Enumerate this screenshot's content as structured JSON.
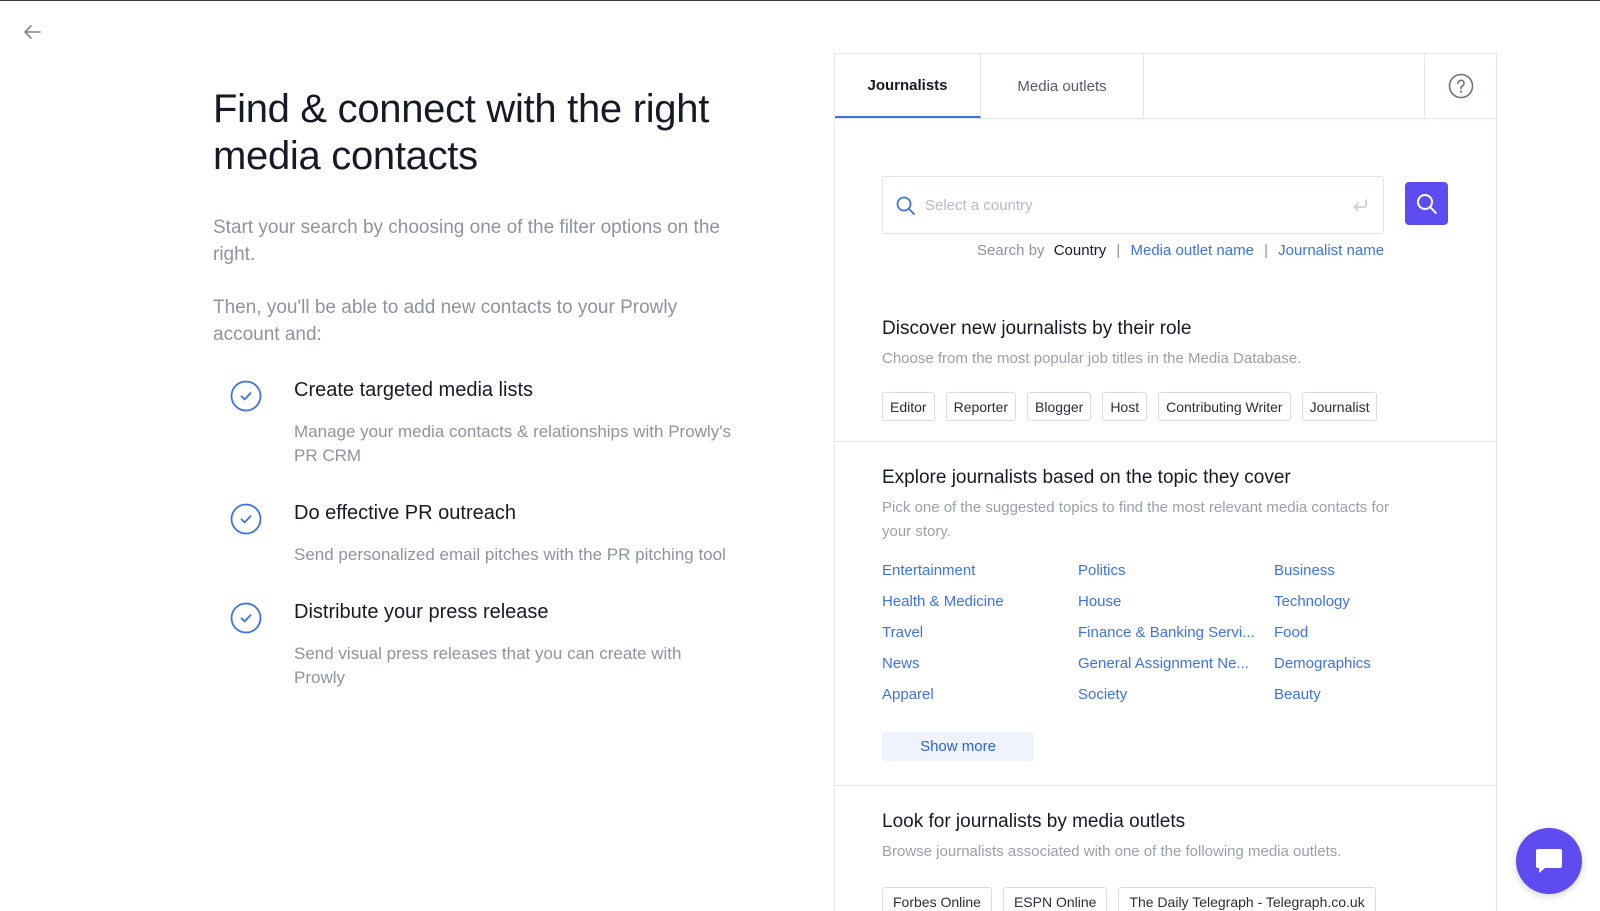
{
  "hero": {
    "title": "Find & connect with the right media contacts",
    "intro": "Start your search by choosing one of the filter options on the right.",
    "intro2": "Then, you'll be able to add new contacts to your Prowly account and:"
  },
  "features": [
    {
      "title": "Create targeted media lists",
      "desc": "Manage your media contacts & relationships with Prowly's PR CRM"
    },
    {
      "title": "Do effective PR outreach",
      "desc": "Send personalized email pitches with the PR pitching tool"
    },
    {
      "title": "Distribute your press release",
      "desc": "Send visual press releases that you can create with Prowly"
    }
  ],
  "tabs": {
    "journalists": "Journalists",
    "outlets": "Media outlets"
  },
  "search": {
    "placeholder": "Select a country",
    "search_by_label": "Search by",
    "options": [
      "Country",
      "Media outlet name",
      "Journalist name"
    ],
    "separator": "|"
  },
  "roles": {
    "title": "Discover new journalists by their role",
    "subtitle": "Choose from the most popular job titles in the Media Database.",
    "chips": [
      "Editor",
      "Reporter",
      "Blogger",
      "Host",
      "Contributing Writer",
      "Journalist"
    ]
  },
  "topics": {
    "title": "Explore journalists based on the topic they cover",
    "subtitle": "Pick one of the suggested topics to find the most relevant media contacts for your story.",
    "items": [
      "Entertainment",
      "Politics",
      "Business",
      "Health & Medicine",
      "House",
      "Technology",
      "Travel",
      "Finance & Banking Servi...",
      "Food",
      "News",
      "General Assignment Ne...",
      "Demographics",
      "Apparel",
      "Society",
      "Beauty"
    ],
    "show_more": "Show more"
  },
  "outlets": {
    "title": "Look for journalists by media outlets",
    "subtitle": "Browse journalists associated with one of the following media outlets.",
    "chips": [
      "Forbes Online",
      "ESPN Online",
      "The Daily Telegraph - Telegraph.co.uk"
    ]
  },
  "colors": {
    "accent": "#5f4cf1",
    "link": "#3b73e6",
    "check": "#3b73e6"
  },
  "icons": {
    "back": "arrow-left-icon",
    "help": "question-circle-icon",
    "search": "search-icon",
    "enter": "enter-return-icon",
    "chat": "chat-bubble-icon",
    "check": "check-circle-icon"
  }
}
